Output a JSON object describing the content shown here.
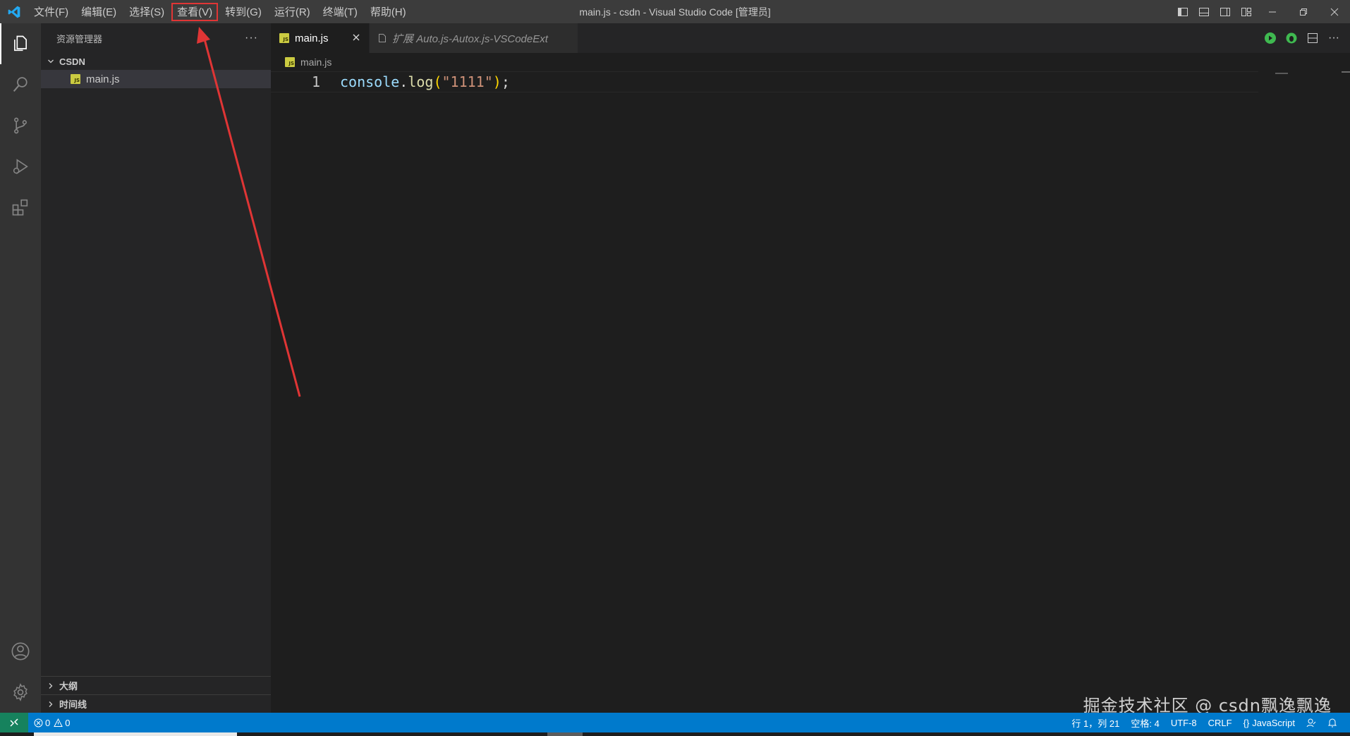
{
  "window": {
    "title": "main.js - csdn - Visual Studio Code [管理员]"
  },
  "menu": [
    {
      "label": "文件(F)",
      "highlighted": false
    },
    {
      "label": "编辑(E)",
      "highlighted": false
    },
    {
      "label": "选择(S)",
      "highlighted": false
    },
    {
      "label": "查看(V)",
      "highlighted": true
    },
    {
      "label": "转到(G)",
      "highlighted": false
    },
    {
      "label": "运行(R)",
      "highlighted": false
    },
    {
      "label": "终端(T)",
      "highlighted": false
    },
    {
      "label": "帮助(H)",
      "highlighted": false
    }
  ],
  "sidebar": {
    "title": "资源管理器",
    "folder": "CSDN",
    "files": [
      "main.js"
    ],
    "bottom_sections": [
      "大纲",
      "时间线"
    ]
  },
  "tabs": [
    {
      "label": "main.js",
      "active": true
    },
    {
      "label": "扩展 Auto.js-Autox.js-VSCodeExt",
      "active": false
    }
  ],
  "breadcrumb": "main.js",
  "editor": {
    "line_number": "1",
    "tokens": {
      "ident": "console",
      "dot": ".",
      "func": "log",
      "open": "(",
      "str": "\"1111\"",
      "close": ")",
      "semi": ";"
    }
  },
  "statusbar": {
    "errors": "0",
    "warnings": "0",
    "position": "行 1，列 21",
    "spaces": "空格: 4",
    "encoding": "UTF-8",
    "eol": "CRLF",
    "language": "JavaScript"
  },
  "watermark": "掘金技术社区 @ csdn飘逸飘逸",
  "colors": {
    "accent": "#007acc",
    "remote": "#16825d",
    "highlight_box": "#e03535",
    "arrow": "#e03535"
  }
}
